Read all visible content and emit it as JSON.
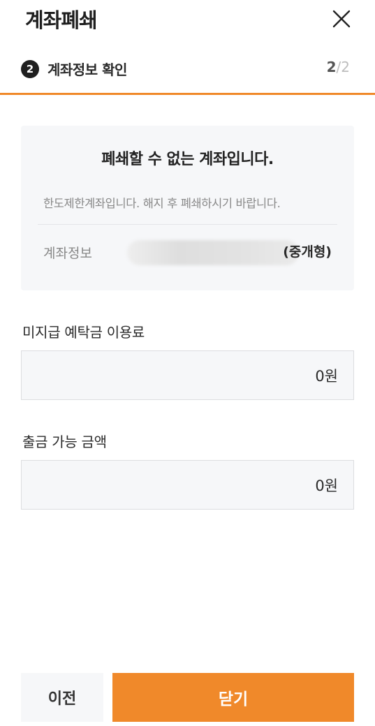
{
  "header": {
    "title": "계좌폐쇄",
    "close_icon": "close-icon"
  },
  "step": {
    "number": "2",
    "label": "계좌정보 확인",
    "current": "2",
    "separator": "/",
    "total": "2",
    "accent_color": "#f0892a"
  },
  "notice": {
    "title": "폐쇄할 수 없는 계좌입니다.",
    "description": "한도제한계좌입니다. 해지 후 폐쇄하시기 바랍니다.",
    "account_label": "계좌정보",
    "account_type": "(중개형)"
  },
  "fields": [
    {
      "label": "미지급 예탁금 이용료",
      "value": "0원"
    },
    {
      "label": "출금 가능 금액",
      "value": "0원"
    }
  ],
  "buttons": {
    "prev": "이전",
    "close": "닫기"
  },
  "colors": {
    "accent": "#f0892a",
    "card_bg": "#f6f7f9"
  }
}
